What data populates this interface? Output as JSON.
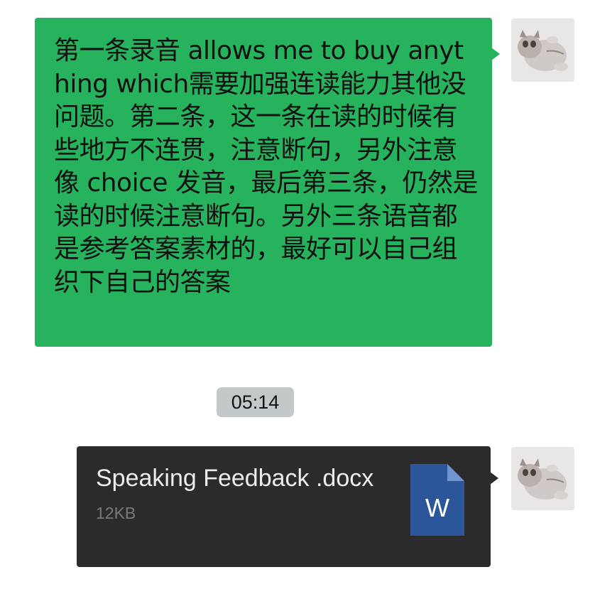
{
  "messages": [
    {
      "type": "text",
      "sender": "self",
      "text": "第一条录音 allows me to buy anything which需要加强连读能力其他没问题。第二条，这一条在读的时候有些地方不连贯，注意断句，另外注意像 choice 发音，最后第三条，仍然是读的时候注意断句。另外三条语音都是参考答案素材的，最好可以自己组织下自己的答案",
      "bubble_color": "#27b25e"
    },
    {
      "type": "timestamp",
      "text": "05:14"
    },
    {
      "type": "file",
      "sender": "self",
      "file_name": "Speaking Feedback .docx",
      "file_size": "12KB",
      "file_icon": "word-doc-icon",
      "file_icon_letter": "W",
      "bubble_color": "#2b2b2b",
      "icon_color": "#2b579a"
    }
  ],
  "avatar": {
    "icon": "cat-photo-avatar"
  }
}
